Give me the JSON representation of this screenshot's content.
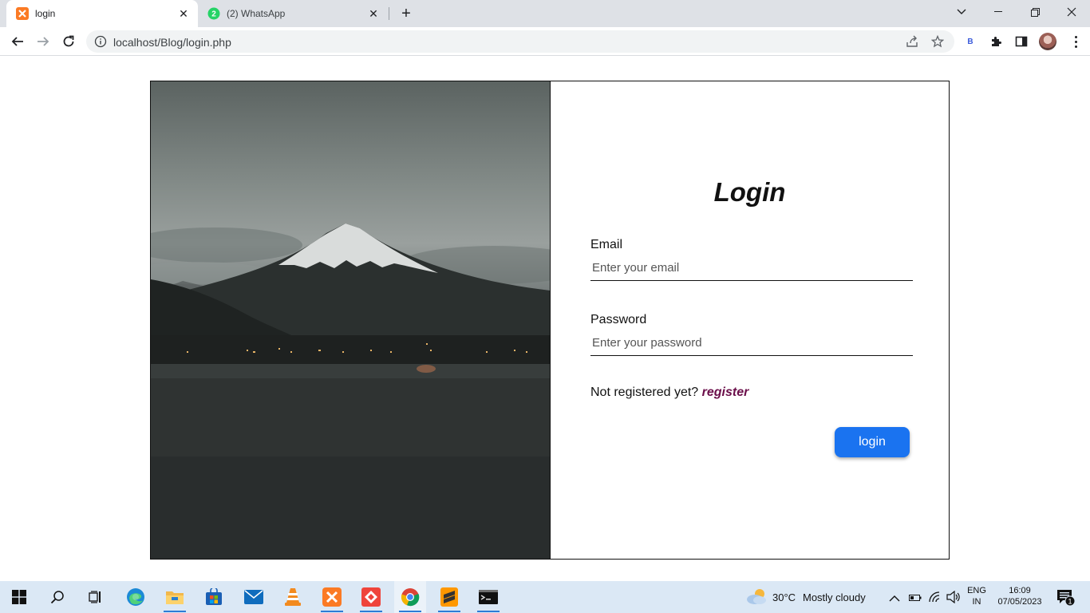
{
  "browser": {
    "tabs": [
      {
        "title": "login",
        "active": true,
        "favicon": "xampp-icon"
      },
      {
        "title": "(2) WhatsApp",
        "active": false,
        "favicon": "whatsapp-icon",
        "badge": "2"
      }
    ],
    "address": {
      "url": "localhost/Blog/login.php"
    },
    "extension_badge": "B"
  },
  "login": {
    "title": "Login",
    "email_label": "Email",
    "email_placeholder": "Enter your email",
    "password_label": "Password",
    "password_placeholder": "Enter your password",
    "register_prompt": "Not registered yet?",
    "register_link": "register",
    "submit_label": "login",
    "colors": {
      "button": "#1a73f0",
      "link": "#6b0f4a"
    }
  },
  "taskbar": {
    "apps": [
      "start-icon",
      "search-icon",
      "task-view-icon",
      "edge-icon",
      "file-explorer-icon",
      "store-icon",
      "mail-icon",
      "vlc-icon",
      "xampp-icon",
      "anydesk-icon",
      "chrome-icon",
      "sublime-icon",
      "terminal-icon"
    ],
    "weather_temp": "30°C",
    "weather_desc": "Mostly cloudy",
    "lang_top": "ENG",
    "lang_bottom": "IN",
    "time": "16:09",
    "date": "07/05/2023",
    "notification_count": "1"
  }
}
